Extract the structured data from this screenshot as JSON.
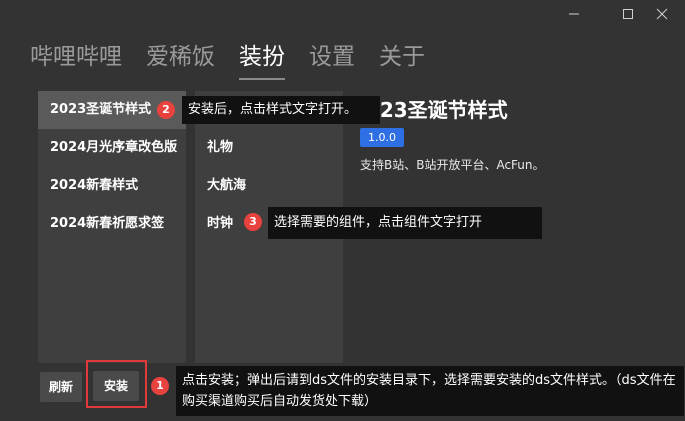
{
  "window_controls": {
    "minimize_icon": "minimize-icon",
    "maximize_icon": "maximize-icon",
    "close_icon": "close-icon"
  },
  "nav": {
    "tabs": [
      {
        "label": "哔哩哔哩"
      },
      {
        "label": "爱稀饭"
      },
      {
        "label": "装扮"
      },
      {
        "label": "设置"
      },
      {
        "label": "关于"
      }
    ],
    "active_index": 2
  },
  "styles": {
    "items": [
      {
        "label": "2023圣诞节样式"
      },
      {
        "label": "2024月光序章改色版"
      },
      {
        "label": "2024新春样式"
      },
      {
        "label": "2024新春祈愿求签"
      }
    ],
    "selected_index": 0
  },
  "components": {
    "items": [
      {
        "label": "礼物"
      },
      {
        "label": "大航海"
      },
      {
        "label": "时钟"
      }
    ]
  },
  "detail": {
    "title": "2023圣诞节样式",
    "version": "1.0.0",
    "description": "支持B站、B站开放平台、AcFun。"
  },
  "buttons": {
    "refresh": "刷新",
    "install": "安装"
  },
  "annotations": [
    {
      "number": "1",
      "text": "点击安装；弹出后请到ds文件的安装目录下，选择需要安装的ds文件样式。（ds文件在购买渠道购买后自动发货处下载）"
    },
    {
      "number": "2",
      "text": "安装后，点击样式文字打开。"
    },
    {
      "number": "3",
      "text": "选择需要的组件，点击组件文字打开"
    }
  ],
  "colors": {
    "background": "#333333",
    "panel": "#3f3f3f",
    "selected": "#5a5a5a",
    "badge": "#2f6fe4",
    "marker": "#e8423f",
    "callout": "#111111"
  }
}
